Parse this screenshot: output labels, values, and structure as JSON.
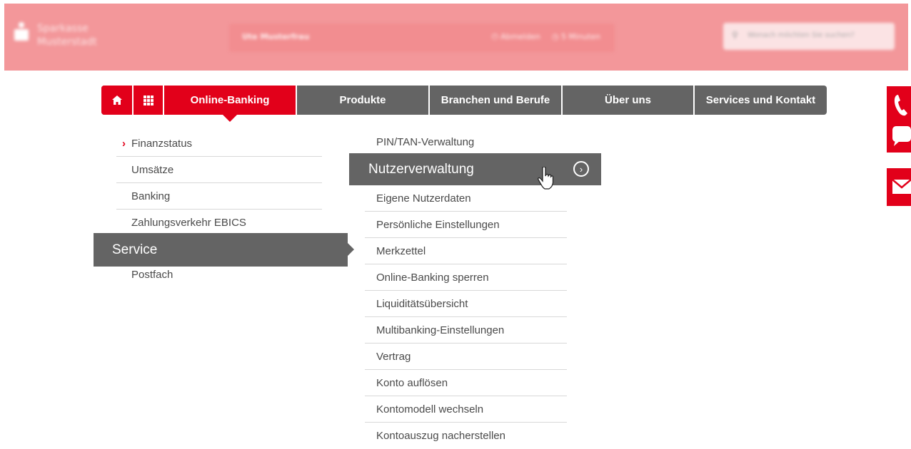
{
  "header": {
    "bank_name_line1": "Sparkasse",
    "bank_name_line2": "Musterstadt",
    "user_name": "Ute Musterfrau",
    "logout": "Abmelden",
    "session_time": "5 Minuten",
    "search_placeholder": "Wonach möchten Sie suchen?"
  },
  "nav": {
    "home_icon": "home-icon",
    "grid_icon": "grid-icon",
    "items": [
      "Online-Banking",
      "Produkte",
      "Branchen und Berufe",
      "Über uns",
      "Services und Kontakt"
    ],
    "active": "Online-Banking"
  },
  "left_menu": {
    "items": [
      "Finanzstatus",
      "Umsätze",
      "Banking",
      "Zahlungsverkehr EBICS"
    ],
    "active_item": "Finanzstatus",
    "highlighted": "Service",
    "after": "Postfach"
  },
  "right_menu": {
    "first": "PIN/TAN-Verwaltung",
    "highlighted": "Nutzerverwaltung",
    "items": [
      "Eigene Nutzerdaten",
      "Persönliche Einstellungen",
      "Merkzettel",
      "Online-Banking sperren",
      "Liquiditätsübersicht",
      "Multibanking-Einstellungen",
      "Vertrag",
      "Konto auflösen",
      "Kontomodell wechseln",
      "Kontoauszug nacherstellen"
    ]
  },
  "colors": {
    "brand_red": "#e2001a",
    "nav_gray": "#646464",
    "header_pink": "#f3979a"
  },
  "side_icons": [
    "phone-icon",
    "mail-icon"
  ]
}
